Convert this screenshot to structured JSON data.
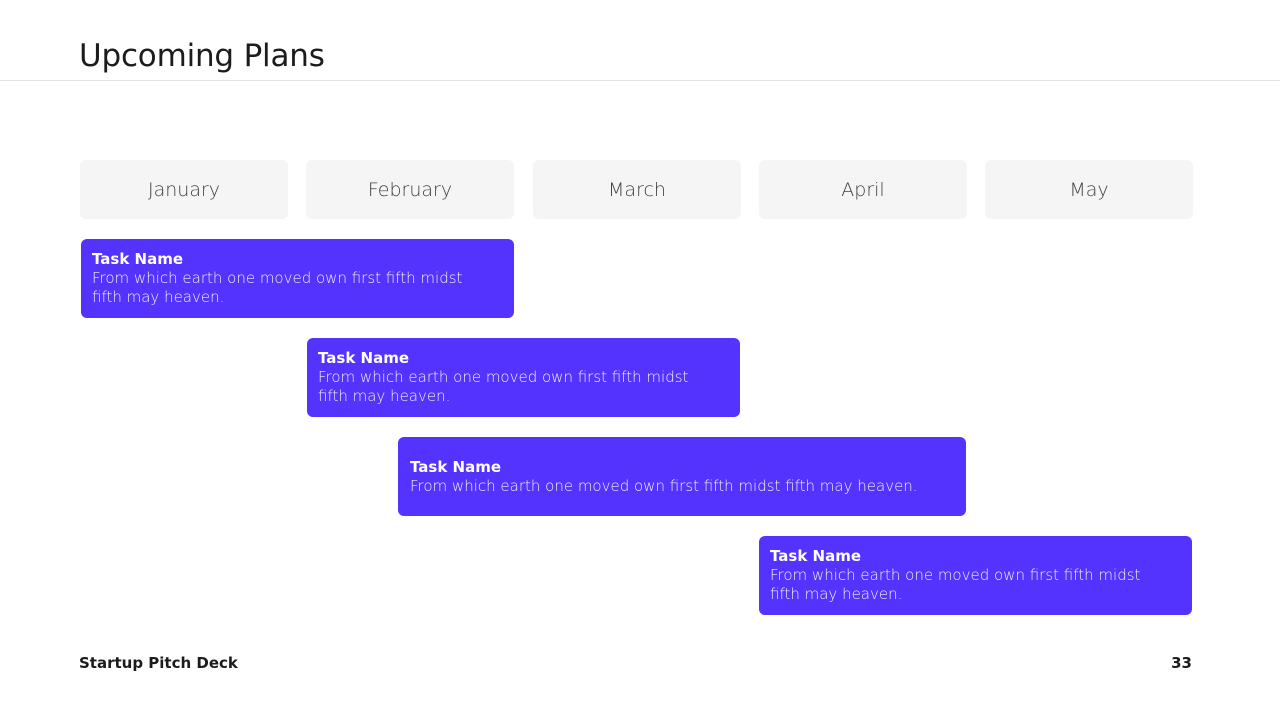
{
  "slide": {
    "title": "Upcoming Plans",
    "footer_left": "Startup Pitch Deck",
    "page_number": "33"
  },
  "timeline": {
    "months": [
      "January",
      "February",
      "March",
      "April",
      "May"
    ],
    "tasks": [
      {
        "name": "Task Name",
        "description": "From which earth one moved own first fifth midst fifth may heaven."
      },
      {
        "name": "Task Name",
        "description": "From which earth one moved own first fifth midst fifth may heaven."
      },
      {
        "name": "Task Name",
        "description": "From which earth one moved own first fifth midst fifth may heaven."
      },
      {
        "name": "Task Name",
        "description": "From which earth one moved own first fifth midst fifth may heaven."
      }
    ]
  },
  "colors": {
    "task_bar": "#5433ff",
    "month_header_bg": "#f5f5f5",
    "text_dark": "#1c1c1c"
  }
}
